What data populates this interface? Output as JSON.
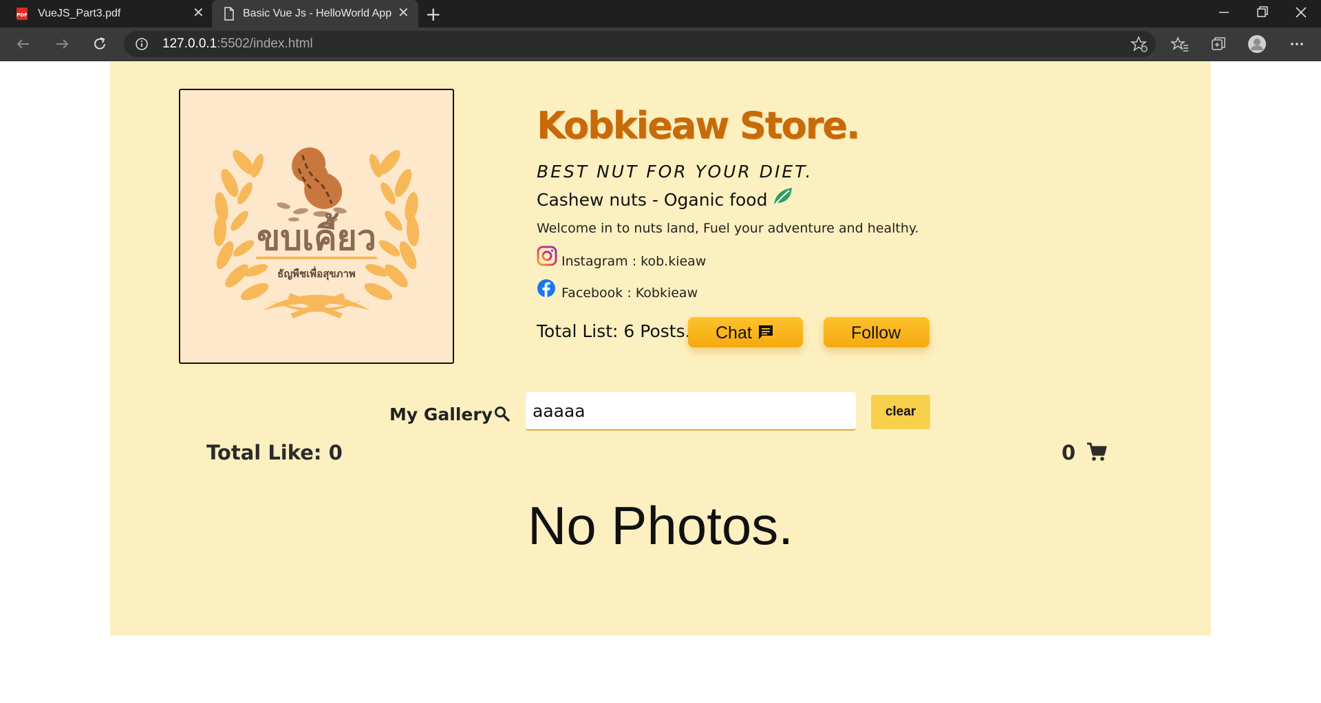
{
  "browser": {
    "tabs": [
      {
        "title": "VueJS_Part3.pdf",
        "icon": "pdf-icon"
      },
      {
        "title": "Basic Vue Js - HelloWorld App",
        "icon": "page-icon",
        "active": true
      }
    ],
    "url_host": "127.0.0.1",
    "url_path": ":5502/index.html"
  },
  "store": {
    "title": "Kobkieaw Store.",
    "tagline": "BEST NUT FOR YOUR DIET.",
    "subtitle": "Cashew nuts - Oganic food",
    "welcome": "Welcome in to nuts land, Fuel your adventure and healthy.",
    "instagram": "Instagram : kob.kieaw",
    "facebook": "Facebook : Kobkieaw",
    "total_list": "Total List: 6 Posts.",
    "chat_label": "Chat",
    "follow_label": "Follow",
    "logo": {
      "thai_name": "ขบเคี้ยว",
      "thai_sub": "ธัญพืชเพื่อสุขภาพ"
    }
  },
  "gallery": {
    "label": "My Gallery",
    "search_value": "aaaaa",
    "clear_label": "clear",
    "total_like": "Total Like: 0",
    "cart_count": "0",
    "empty_message": "No Photos."
  },
  "colors": {
    "page_bg": "#fdf0c0",
    "accent": "#f6a90f",
    "title": "#c76a0a"
  }
}
